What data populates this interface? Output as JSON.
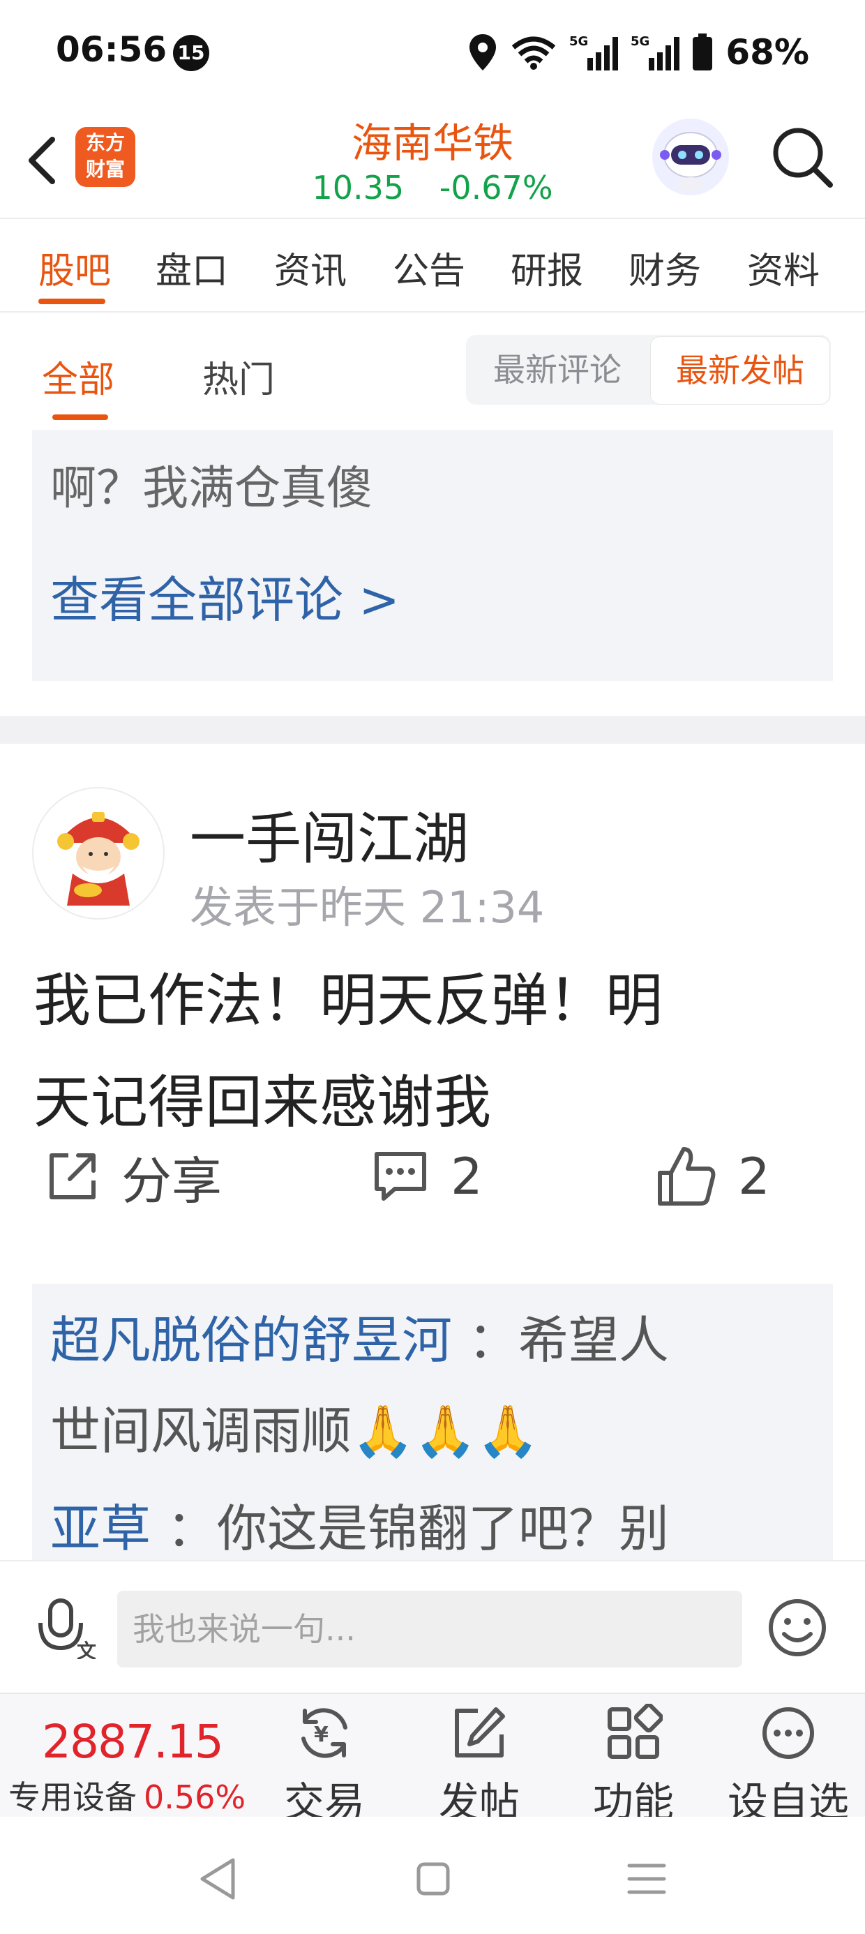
{
  "status_bar": {
    "time": "06:56",
    "notification_count": "15",
    "battery": "68%",
    "signal_label_1": "5G",
    "signal_label_2": "5G"
  },
  "header": {
    "logo_line1": "东方",
    "logo_line2": "财富",
    "stock_name": "海南华铁",
    "price": "10.35",
    "change": "-0.67%"
  },
  "main_tabs": [
    "股吧",
    "盘口",
    "资讯",
    "公告",
    "研报",
    "财务",
    "资料"
  ],
  "sub_tabs": {
    "all": "全部",
    "hot": "热门",
    "sort_latest_comment": "最新评论",
    "sort_latest_post": "最新发帖"
  },
  "feed": {
    "prev_comment_text": "啊？我满仓真傻",
    "view_all_comments": "查看全部评论 >",
    "post": {
      "author": "一手闯江湖",
      "time": "发表于昨天 21:34",
      "body_line1": "我已作法！明天反弹！明",
      "body_line2": "天记得回来感谢我",
      "share_label": "分享",
      "comment_count": "2",
      "like_count": "2"
    },
    "replies": [
      {
        "name": "超凡脱俗的舒昱河",
        "sep": " ：",
        "text_line1": "希望人",
        "text_line2": "世间风调雨顺🙏🙏🙏"
      },
      {
        "name": "亚草",
        "sep": " ：",
        "text_line1": "你这是锦翻了吧？别"
      }
    ]
  },
  "input_bar": {
    "placeholder": "我也来说一句..."
  },
  "bottom_bar": {
    "index_value": "2887.15",
    "index_name": "专用设备",
    "index_change": "0.56%",
    "items": [
      "交易",
      "发帖",
      "功能",
      "设自选"
    ]
  },
  "colors": {
    "accent": "#e9540f",
    "up_red": "#e0242b",
    "down_green": "#13a24a",
    "link_blue": "#2f63a8"
  }
}
